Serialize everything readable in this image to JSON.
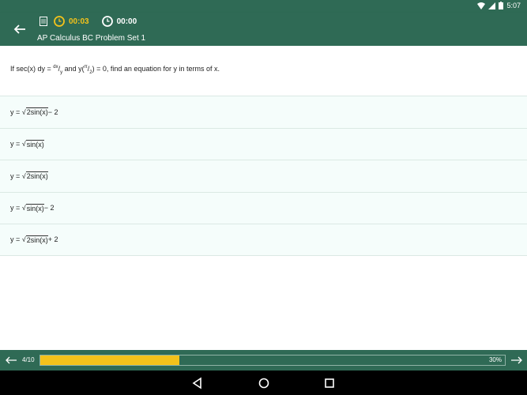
{
  "status": {
    "time": "5:07"
  },
  "toolbar": {
    "elapsed_timer": "00:03",
    "total_timer": "00:00",
    "title": "AP Calculus BC Problem Set 1"
  },
  "question": {
    "prefix": "If sec(x) dy = ",
    "frac_num": "dx",
    "frac_den": "y",
    "mid": " and y(",
    "arg_num": "π",
    "arg_den": "2",
    "suffix": ") = 0, find an equation for y in terms of x."
  },
  "answers": [
    {
      "lhs": "y = √",
      "radicand": "2sin(x)",
      "tail": " − 2"
    },
    {
      "lhs": "y = √",
      "radicand": "sin(x)",
      "tail": ""
    },
    {
      "lhs": "y = √",
      "radicand": "2sin(x)",
      "tail": ""
    },
    {
      "lhs": "y = √",
      "radicand": "sin(x)",
      "tail": " − 2"
    },
    {
      "lhs": "y = √",
      "radicand": "2sin(x)",
      "tail": " + 2"
    }
  ],
  "progress": {
    "label": "4/10",
    "percent_text": "30%",
    "fraction": 0.3
  },
  "colors": {
    "primary": "#2f6a55",
    "accent": "#f3c21b",
    "answer_bg": "#f5fdfb"
  }
}
